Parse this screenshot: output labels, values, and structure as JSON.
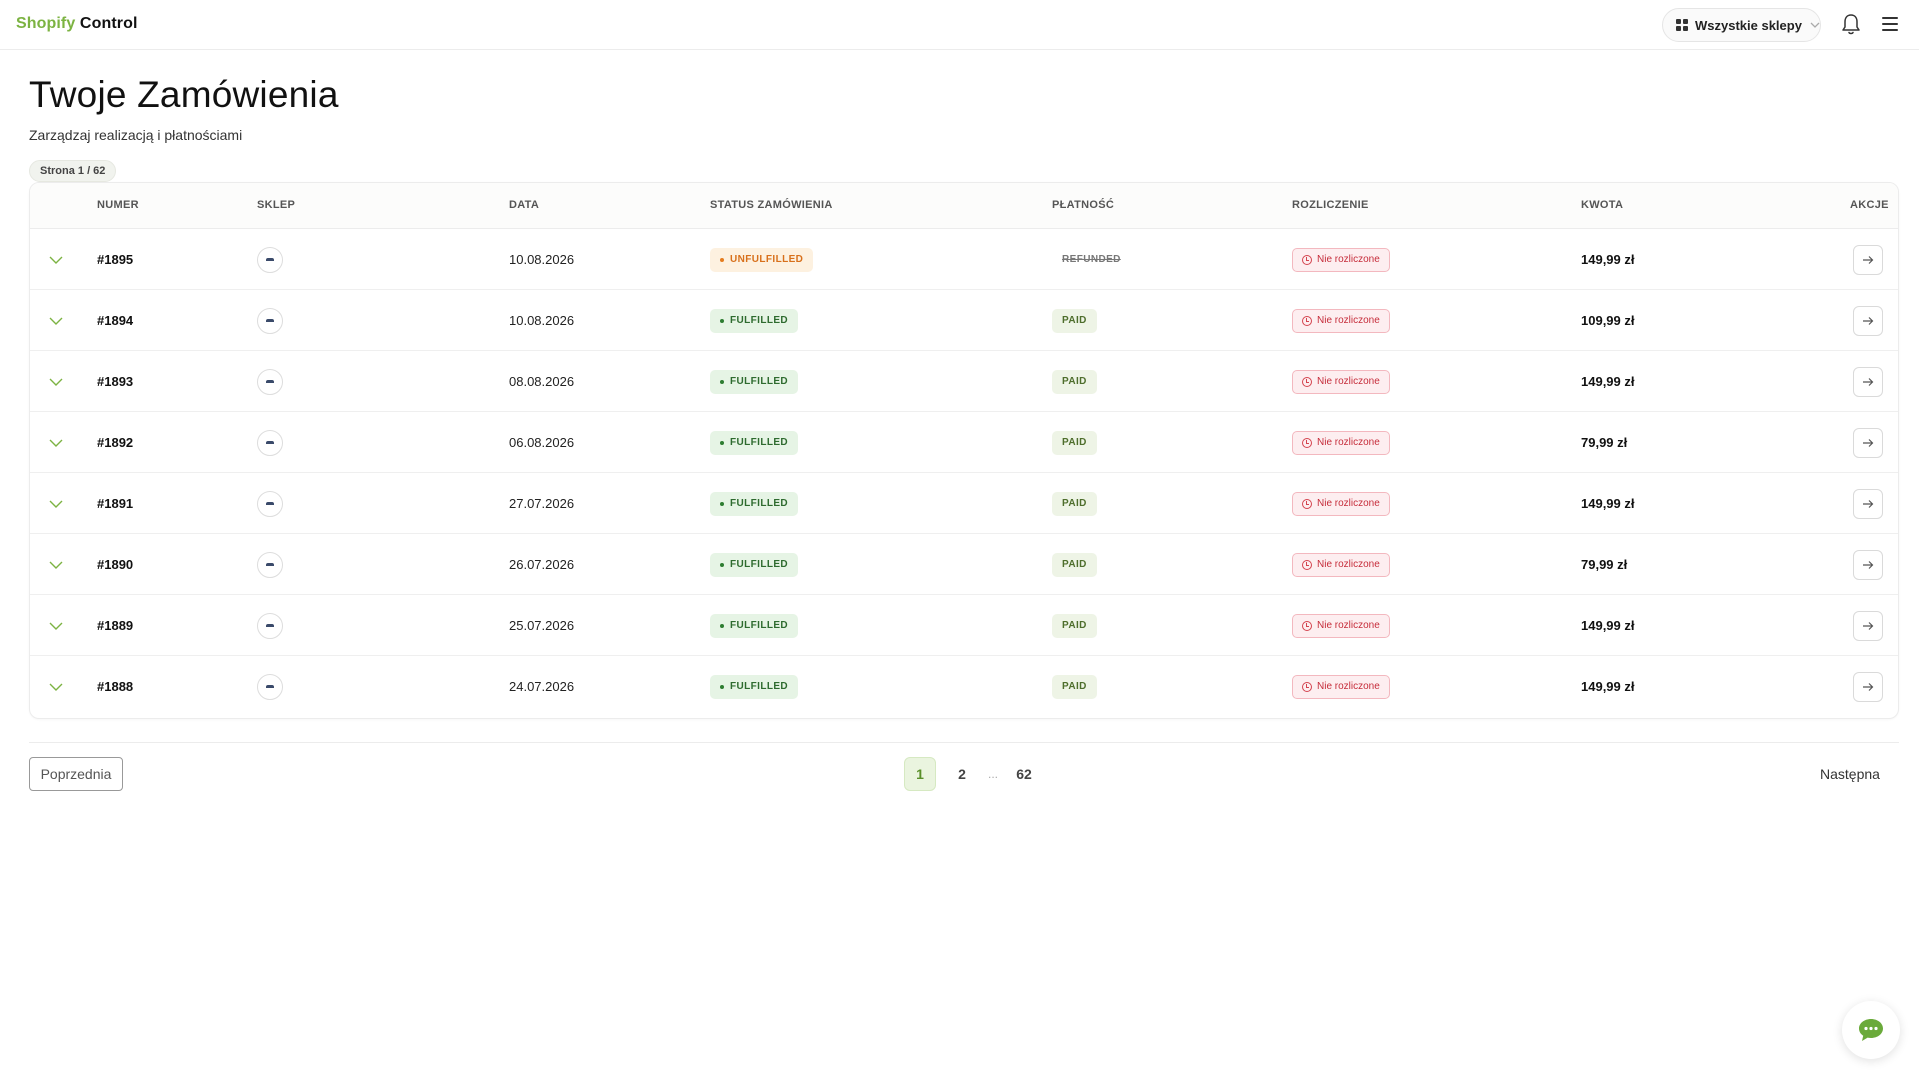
{
  "header": {
    "logo_brand": "Shopify",
    "logo_rest": "Control",
    "store_selector": "Wszystkie sklepy"
  },
  "page": {
    "title": "Twoje Zamówienia",
    "subtitle": "Zarządzaj realizacją i płatnościami",
    "page_indicator": "Strona 1 / 62"
  },
  "table": {
    "columns": [
      "NUMER",
      "SKLEP",
      "DATA",
      "STATUS ZAMÓWIENIA",
      "PŁATNOŚĆ",
      "ROZLICZENIE",
      "KWOTA",
      "AKCJE"
    ],
    "rows": [
      {
        "number": "#1895",
        "date": "10.08.2026",
        "status": "UNFULFILLED",
        "payment": "REFUNDED",
        "settlement": "Nie rozliczone",
        "amount": "149,99 zł"
      },
      {
        "number": "#1894",
        "date": "10.08.2026",
        "status": "FULFILLED",
        "payment": "PAID",
        "settlement": "Nie rozliczone",
        "amount": "109,99 zł"
      },
      {
        "number": "#1893",
        "date": "08.08.2026",
        "status": "FULFILLED",
        "payment": "PAID",
        "settlement": "Nie rozliczone",
        "amount": "149,99 zł"
      },
      {
        "number": "#1892",
        "date": "06.08.2026",
        "status": "FULFILLED",
        "payment": "PAID",
        "settlement": "Nie rozliczone",
        "amount": "79,99 zł"
      },
      {
        "number": "#1891",
        "date": "27.07.2026",
        "status": "FULFILLED",
        "payment": "PAID",
        "settlement": "Nie rozliczone",
        "amount": "149,99 zł"
      },
      {
        "number": "#1890",
        "date": "26.07.2026",
        "status": "FULFILLED",
        "payment": "PAID",
        "settlement": "Nie rozliczone",
        "amount": "79,99 zł"
      },
      {
        "number": "#1889",
        "date": "25.07.2026",
        "status": "FULFILLED",
        "payment": "PAID",
        "settlement": "Nie rozliczone",
        "amount": "149,99 zł"
      },
      {
        "number": "#1888",
        "date": "24.07.2026",
        "status": "FULFILLED",
        "payment": "PAID",
        "settlement": "Nie rozliczone",
        "amount": "149,99 zł"
      }
    ]
  },
  "pagination": {
    "prev_label": "Poprzednia",
    "next_label": "Następna",
    "pages": [
      "1",
      "2"
    ],
    "dots": "...",
    "last_page": "62"
  },
  "icons": {
    "grid": "grid-icon",
    "bell": "bell-icon",
    "menu": "hamburger-menu-icon",
    "expand": "chevron-down-icon",
    "action": "arrow-right-icon",
    "chat": "chat-bubble-icon",
    "clock": "clock-icon"
  },
  "colors": {
    "brand": "#7cb342",
    "fulfilled": "#2e7d32",
    "unfulfilled": "#e57c1f",
    "unsettled": "#c62d3b"
  }
}
